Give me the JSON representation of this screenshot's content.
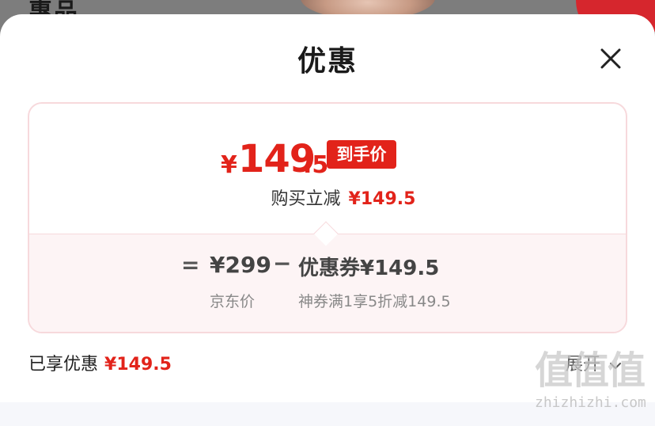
{
  "background": {
    "section_label": "惠品"
  },
  "sheet": {
    "title": "优惠",
    "close_icon": "close-icon"
  },
  "price_card": {
    "final_price": {
      "currency": "¥",
      "integer": "149",
      "decimal": ".5",
      "badge": "到手价"
    },
    "instant_discount": {
      "label": "购买立减",
      "amount": "¥149.5"
    },
    "breakdown": {
      "equals": "=",
      "original_price": "¥299",
      "original_caption": "京东价",
      "minus": "−",
      "coupon_amount": "优惠券¥149.5",
      "coupon_caption": "神券满1享5折减149.5"
    }
  },
  "summary": {
    "enjoyed_label": "已享优惠",
    "enjoyed_amount": "¥149.5",
    "expand_label": "展开"
  },
  "watermark": {
    "glyphs": "值值值",
    "site": "zhizhizhi.com"
  },
  "colors": {
    "accent_red": "#e2231a",
    "card_border": "#f7d9dc",
    "breakdown_bg": "#fdf4f5"
  }
}
